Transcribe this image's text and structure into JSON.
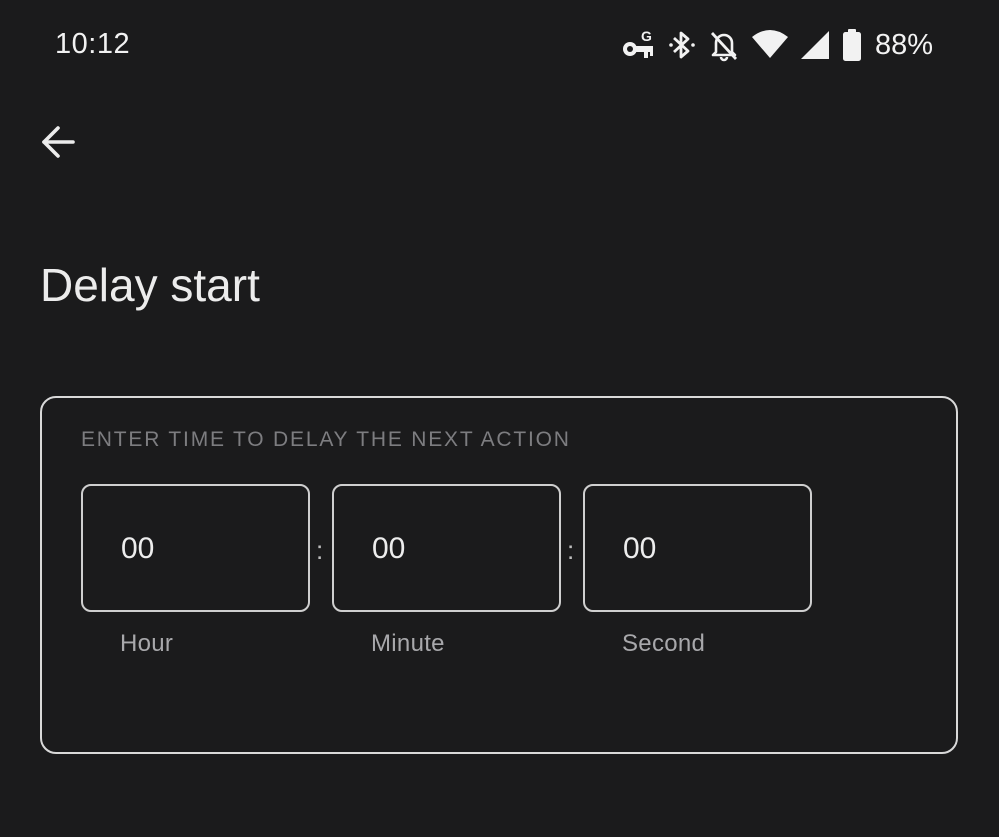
{
  "status_bar": {
    "time": "10:12",
    "battery_percent": "88%",
    "icons": [
      "vpn-key-icon",
      "bluetooth-icon",
      "notifications-off-icon",
      "wifi-icon",
      "cell-signal-icon",
      "battery-icon"
    ]
  },
  "header": {
    "back_icon": "arrow-back-icon",
    "title": "Delay start"
  },
  "delay_card": {
    "caption": "ENTER TIME TO DELAY THE NEXT ACTION",
    "separator": ":",
    "fields": [
      {
        "value": "00",
        "label": "Hour"
      },
      {
        "value": "00",
        "label": "Minute"
      },
      {
        "value": "00",
        "label": "Second"
      }
    ]
  },
  "colors": {
    "background": "#1b1b1c",
    "text": "#e6e6e6",
    "caption": "#7d7d80",
    "border": "#d9d9d9"
  }
}
